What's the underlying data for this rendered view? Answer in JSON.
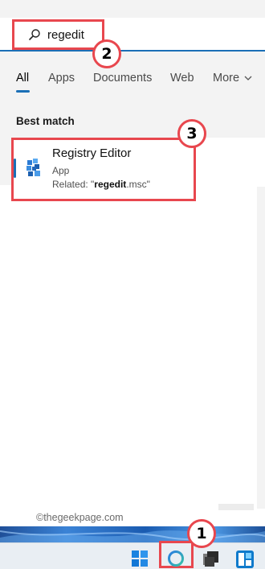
{
  "search": {
    "query": "regedit"
  },
  "tabs": [
    {
      "label": "All"
    },
    {
      "label": "Apps"
    },
    {
      "label": "Documents"
    },
    {
      "label": "Web"
    },
    {
      "label": "More"
    }
  ],
  "best_match": {
    "heading": "Best match",
    "title": "Registry Editor",
    "type": "App",
    "related_prefix": "Related: \"",
    "related_value": "regedit",
    "related_suffix": ".msc\""
  },
  "steps": [
    "1",
    "2",
    "3"
  ],
  "watermark": "©thegeekpage.com",
  "colors": {
    "accent": "#1b6fb6",
    "annotation_red": "#e8474e",
    "panel": "#f3f3f3"
  },
  "taskbar": {
    "icons": [
      "start-icon",
      "search-icon",
      "task-view-icon",
      "widgets-icon"
    ]
  }
}
